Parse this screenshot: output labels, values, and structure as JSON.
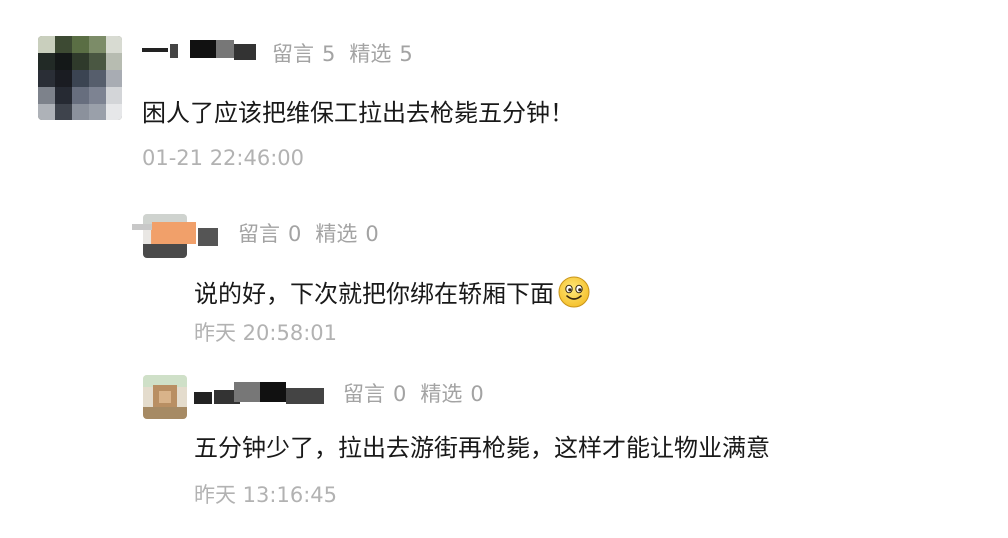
{
  "comments": [
    {
      "stats_reply_label": "留言",
      "stats_reply_count": "5",
      "stats_pick_label": "精选",
      "stats_pick_count": "5",
      "text": "困人了应该把维保工拉出去枪毙五分钟！",
      "time": "01-21 22:46:00"
    },
    {
      "stats_reply_label": "留言",
      "stats_reply_count": "0",
      "stats_pick_label": "精选",
      "stats_pick_count": "0",
      "text": "说的好，下次就把你绑在轿厢下面",
      "emoji": "smile-emoji",
      "time": "昨天 20:58:01"
    },
    {
      "stats_reply_label": "留言",
      "stats_reply_count": "0",
      "stats_pick_label": "精选",
      "stats_pick_count": "0",
      "text": "五分钟少了，拉出去游街再枪毙，这样才能让物业满意",
      "time": "昨天 13:16:45"
    }
  ],
  "colors": {
    "text": "#191919",
    "meta": "#a3a3a3",
    "timestamp": "#b2b2b2",
    "background": "#ffffff"
  }
}
